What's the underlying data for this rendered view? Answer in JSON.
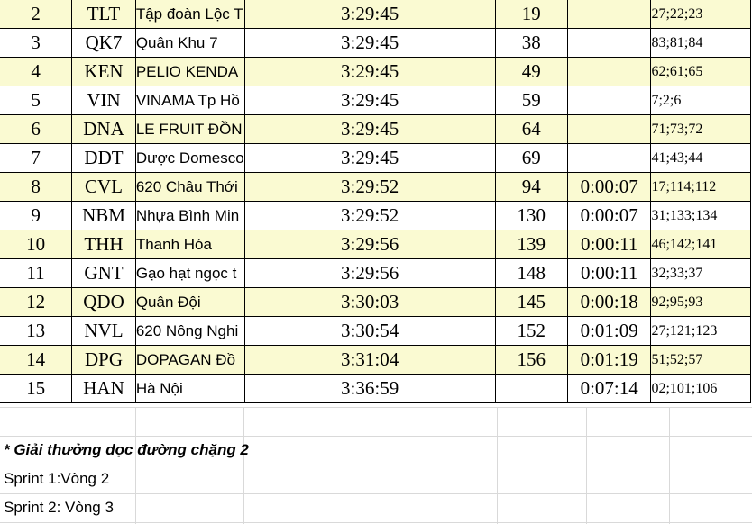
{
  "rows": [
    {
      "rank": "2",
      "code": "TLT",
      "team": "Tập đoàn Lộc T",
      "time": "3:29:45",
      "points": "19",
      "gap": "",
      "bibs": "27;22;23",
      "highlight": true
    },
    {
      "rank": "3",
      "code": "QK7",
      "team": "Quân Khu 7",
      "time": "3:29:45",
      "points": "38",
      "gap": "",
      "bibs": "83;81;84",
      "highlight": false
    },
    {
      "rank": "4",
      "code": "KEN",
      "team": "PELIO KENDA",
      "time": "3:29:45",
      "points": "49",
      "gap": "",
      "bibs": "62;61;65",
      "highlight": true
    },
    {
      "rank": "5",
      "code": "VIN",
      "team": "VINAMA Tp Hồ",
      "time": "3:29:45",
      "points": "59",
      "gap": "",
      "bibs": "7;2;6",
      "highlight": false
    },
    {
      "rank": "6",
      "code": "DNA",
      "team": "LE FRUIT ĐỒN",
      "time": "3:29:45",
      "points": "64",
      "gap": "",
      "bibs": "71;73;72",
      "highlight": true
    },
    {
      "rank": "7",
      "code": "DDT",
      "team": "Dược Domesco",
      "time": "3:29:45",
      "points": "69",
      "gap": "",
      "bibs": "41;43;44",
      "highlight": false
    },
    {
      "rank": "8",
      "code": "CVL",
      "team": "620 Châu Thới",
      "time": "3:29:52",
      "points": "94",
      "gap": "0:00:07",
      "bibs": "17;114;112",
      "highlight": true
    },
    {
      "rank": "9",
      "code": "NBM",
      "team": "Nhựa Bình Min",
      "time": "3:29:52",
      "points": "130",
      "gap": "0:00:07",
      "bibs": "31;133;134",
      "highlight": false
    },
    {
      "rank": "10",
      "code": "THH",
      "team": "Thanh Hóa",
      "time": "3:29:56",
      "points": "139",
      "gap": "0:00:11",
      "bibs": "46;142;141",
      "highlight": true
    },
    {
      "rank": "11",
      "code": "GNT",
      "team": "Gạo hạt ngọc t",
      "time": "3:29:56",
      "points": "148",
      "gap": "0:00:11",
      "bibs": "32;33;37",
      "highlight": false
    },
    {
      "rank": "12",
      "code": "QDO",
      "team": "Quân Đội",
      "time": "3:30:03",
      "points": "145",
      "gap": "0:00:18",
      "bibs": "92;95;93",
      "highlight": true
    },
    {
      "rank": "13",
      "code": "NVL",
      "team": "620 Nông Nghi",
      "time": "3:30:54",
      "points": "152",
      "gap": "0:01:09",
      "bibs": "27;121;123",
      "highlight": false
    },
    {
      "rank": "14",
      "code": "DPG",
      "team": "DOPAGAN Đồ",
      "time": "3:31:04",
      "points": "156",
      "gap": "0:01:19",
      "bibs": "51;52;57",
      "highlight": true
    },
    {
      "rank": "15",
      "code": "HAN",
      "team": "Hà Nội",
      "time": "3:36:59",
      "points": "",
      "gap": "0:07:14",
      "bibs": "02;101;106",
      "highlight": false
    }
  ],
  "notes": {
    "heading": "* Giải thưởng dọc đường chặng 2",
    "sprint1": "Sprint 1:Vòng 2",
    "sprint2": "Sprint 2: Vòng 3"
  },
  "colors": {
    "highlight_row": "#fafad2",
    "grid": "#d9d9d9"
  }
}
